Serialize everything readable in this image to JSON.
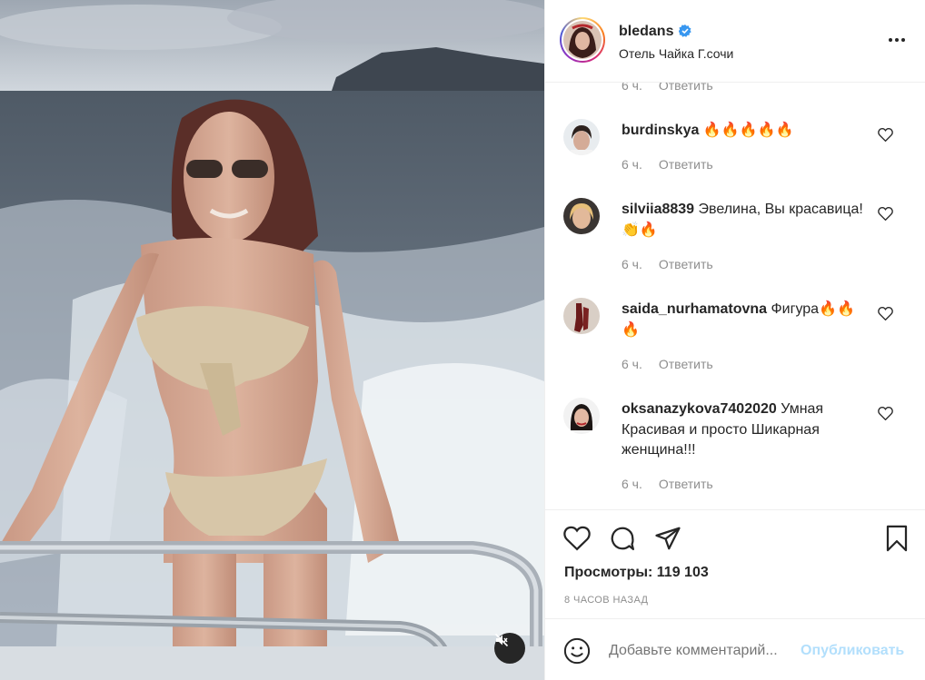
{
  "post": {
    "username": "bledans",
    "location": "Отель Чайка Г.сочи",
    "verified": true
  },
  "top_meta": {
    "time": "6 ч.",
    "reply": "Ответить"
  },
  "comments": [
    {
      "username": "burdinskya",
      "text": "🔥🔥🔥🔥🔥",
      "time": "6 ч.",
      "reply": "Ответить"
    },
    {
      "username": "silviia8839",
      "text": "Эвелина, Вы красавица! 👏🔥",
      "time": "6 ч.",
      "reply": "Ответить"
    },
    {
      "username": "saida_nurhamatovna",
      "text": "Фигура🔥🔥🔥",
      "time": "6 ч.",
      "reply": "Ответить"
    },
    {
      "username": "oksanazykova7402020",
      "text": "Умная Красивая и просто Шикарная женщина!!!",
      "time": "6 ч.",
      "reply": "Ответить"
    }
  ],
  "stats": {
    "views": "Просмотры: 119 103",
    "time_ago": "8 ЧАСОВ НАЗАД"
  },
  "composer": {
    "placeholder": "Добавьте комментарий...",
    "publish": "Опубликовать"
  },
  "icons": {
    "verified": "verified-badge-icon",
    "more": "more-options-icon",
    "like": "heart-icon",
    "comment": "comment-icon",
    "share": "paper-plane-icon",
    "save": "bookmark-icon",
    "emoji": "emoji-icon",
    "mute": "muted-speaker-icon"
  },
  "colors": {
    "link_disabled": "#b2dffc",
    "secondary_text": "#8e8e8e",
    "verified": "#3897f0"
  }
}
